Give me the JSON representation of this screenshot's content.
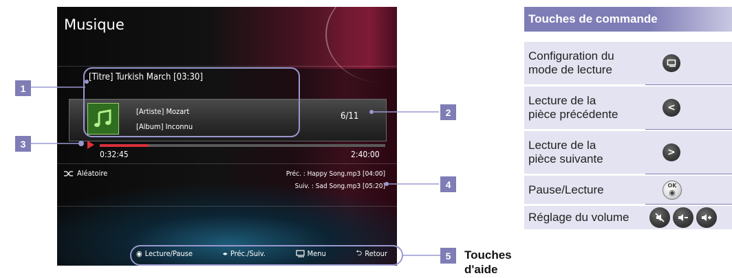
{
  "screen": {
    "title": "Musique",
    "track_title": "[Titre] Turkish March [03:30]",
    "artist": "[Artiste] Mozart",
    "album": "[Album] Inconnu",
    "track_count": "6/11",
    "elapsed": "0:32:45",
    "total": "2:40:00",
    "progress_fraction": 0.17,
    "shuffle_label": "Aléatoire",
    "prev_track": "Préc. : Happy Song.mp3 [04:00]",
    "next_track": "Suiv. : Sad Song.mp3 [05:20]",
    "help_bar": {
      "play_pause": "Lecture/Pause",
      "prev_next": "Préc./Suiv.",
      "menu": "Menu",
      "return": "Retour"
    }
  },
  "callouts": [
    "1",
    "2",
    "3",
    "4",
    "5"
  ],
  "help_keys_label_line1": "Touches",
  "help_keys_label_line2": "d'aide",
  "controls": {
    "header": "Touches de commande",
    "rows": [
      {
        "label_line1": "Configuration du",
        "label_line2": "mode de lecture",
        "icon": "menu-icon"
      },
      {
        "label_line1": "Lecture de la",
        "label_line2": "pièce précédente",
        "icon": "chevron-left-icon"
      },
      {
        "label_line1": "Lecture de la",
        "label_line2": "pièce suivante",
        "icon": "chevron-right-icon"
      },
      {
        "label_line1": "Pause/Lecture",
        "label_line2": "",
        "icon": "ok-icon"
      },
      {
        "label_line1": "Réglage du volume",
        "label_line2": "",
        "icon": "mute-icon"
      }
    ],
    "ok_text": "OK"
  },
  "colors": {
    "accent": "#7f7db6",
    "table_bg": "#e3e3f1",
    "progress": "#d8313a"
  }
}
